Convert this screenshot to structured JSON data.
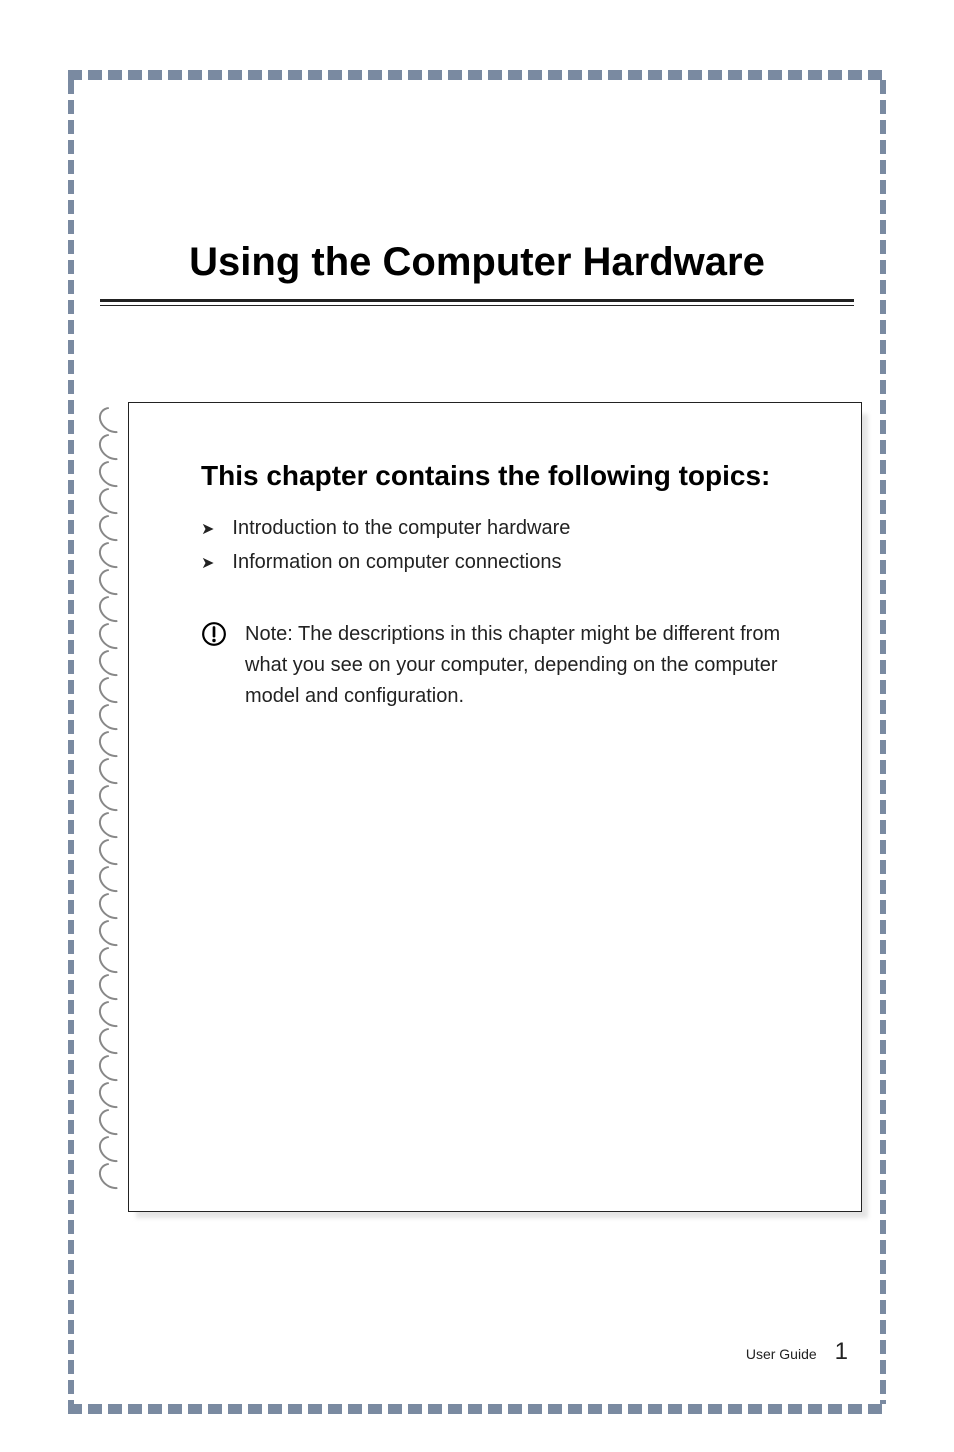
{
  "chapter": {
    "title": "Using the Computer Hardware",
    "section_heading": "This chapter contains the following topics:",
    "topics": [
      "Introduction to the computer hardware",
      "Information on computer connections"
    ],
    "note": {
      "label": "Note:",
      "body": "The descriptions in this chapter might be different from what you see on your computer, depending on the computer model and configuration."
    }
  },
  "footer": {
    "label": "User Guide",
    "page_number": "1"
  },
  "icons": {
    "topic_marker": "arrow-right-icon",
    "note_marker": "alert-circle-icon",
    "spiral_binding": "spiral-icon"
  }
}
